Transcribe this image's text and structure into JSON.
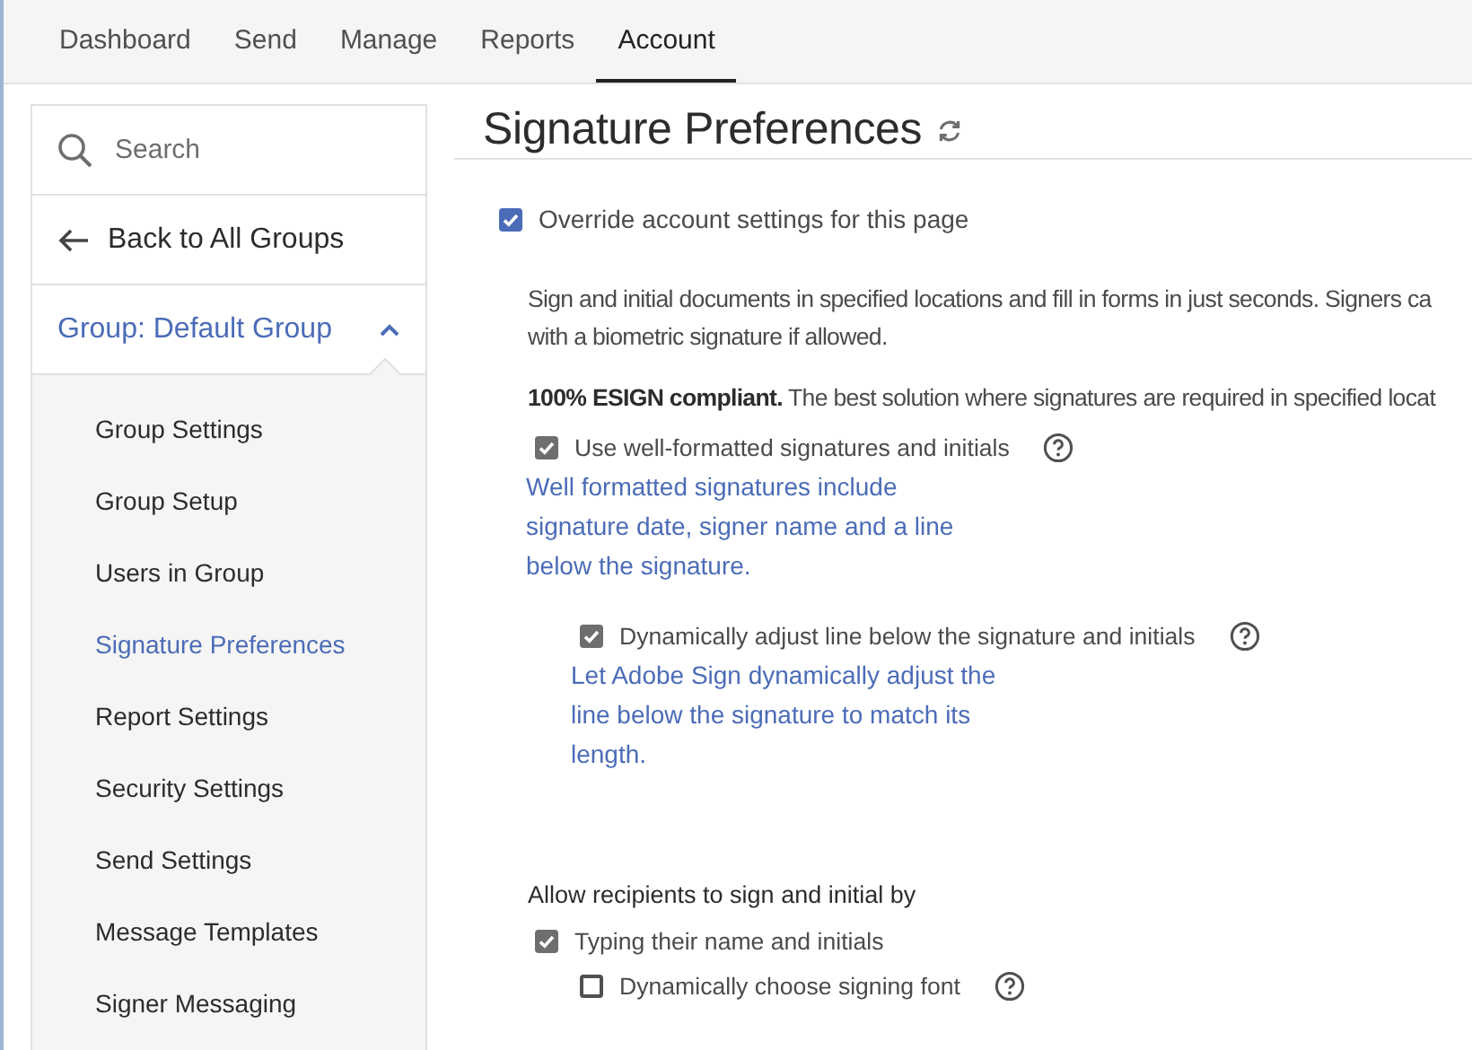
{
  "nav": {
    "tabs": [
      {
        "label": "Dashboard",
        "selected": false
      },
      {
        "label": "Send",
        "selected": false
      },
      {
        "label": "Manage",
        "selected": false
      },
      {
        "label": "Reports",
        "selected": false
      },
      {
        "label": "Account",
        "selected": true
      }
    ]
  },
  "sidebar": {
    "search": {
      "placeholder": "Search"
    },
    "back_link": "Back to All Groups",
    "group": {
      "label": "Group: Default Group",
      "expanded": true
    },
    "items": [
      {
        "label": "Group Settings",
        "selected": false
      },
      {
        "label": "Group Setup",
        "selected": false
      },
      {
        "label": "Users in Group",
        "selected": false
      },
      {
        "label": "Signature Preferences",
        "selected": true
      },
      {
        "label": "Report Settings",
        "selected": false
      },
      {
        "label": "Security Settings",
        "selected": false
      },
      {
        "label": "Send Settings",
        "selected": false
      },
      {
        "label": "Message Templates",
        "selected": false
      },
      {
        "label": "Signer Messaging",
        "selected": false
      }
    ]
  },
  "main": {
    "title": "Signature Preferences",
    "override": {
      "label": "Override account settings for this page",
      "checked": true
    },
    "description_lines": [
      "Sign and initial documents in specified locations and fill in forms in just seconds. Signers ca",
      "with a biometric signature if allowed."
    ],
    "compliance": "**100% ESIGN compliant.** The best solution where signatures are required in specified locat",
    "options": [
      {
        "label": "Use well-formatted signatures and initials",
        "checked": true,
        "help": true,
        "hint": "Well formatted signatures include signature date, signer name and a line below the signature.",
        "children": [
          {
            "label": "Dynamically adjust line below the signature and initials",
            "checked": true,
            "help": true,
            "hint": "Let Adobe Sign dynamically adjust the line below the signature to match its length."
          }
        ]
      }
    ],
    "allow_heading": "Allow recipients to sign and initial by",
    "allow_options": [
      {
        "label": "Typing their name and initials",
        "checked": true,
        "help": false,
        "children": [
          {
            "label": "Dynamically choose signing font",
            "checked": false,
            "help": true
          }
        ]
      }
    ]
  }
}
